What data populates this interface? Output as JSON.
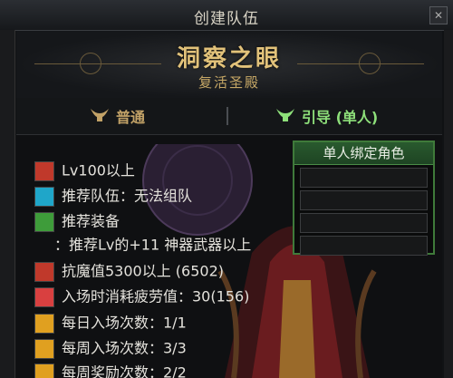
{
  "window": {
    "title": "创建队伍"
  },
  "banner": {
    "title": "洞察之眼",
    "subtitle": "复活圣殿"
  },
  "modes": [
    {
      "label": "普通",
      "icon": "horned-helmet-icon",
      "color": "#c2a267"
    },
    {
      "label": "引导 (单人)",
      "icon": "horned-helmet-icon",
      "color": "#8ee07a"
    }
  ],
  "info": [
    {
      "icon": "level-badge-icon",
      "text": "Lv100以上",
      "color": "#c0392b"
    },
    {
      "icon": "party-icon",
      "text": "推荐队伍：无法组队",
      "color": "#1fa6c9"
    },
    {
      "icon": "sword-icon",
      "text": "推荐装备",
      "color": "#3e9c3a"
    },
    {
      "icon": "",
      "text": "：推荐Lv的+11 神器武器以上"
    },
    {
      "icon": "demon-resist-icon",
      "text": "抗魔值5300以上 (6502)",
      "color": "#c0392b"
    },
    {
      "icon": "fatigue-icon",
      "text": "入场时消耗疲劳值：30(156)",
      "color": "#d94040"
    },
    {
      "icon": "ticket-icon",
      "text": "每日入场次数：1/1",
      "color": "#e0a020"
    },
    {
      "icon": "ticket-icon",
      "text": "每周入场次数：3/3",
      "color": "#e0a020"
    },
    {
      "icon": "ticket-icon",
      "text": "每周奖励次数：2/2",
      "color": "#e0a020"
    }
  ],
  "bind_panel": {
    "title": "单人绑定角色",
    "slots": [
      "",
      "",
      "",
      ""
    ]
  }
}
